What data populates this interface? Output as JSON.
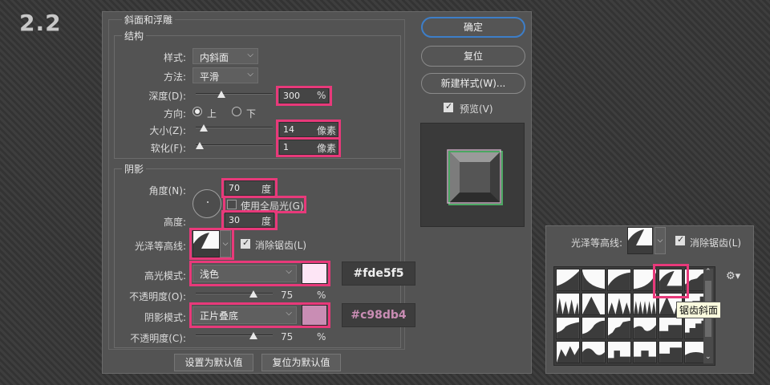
{
  "step_label": "2.2",
  "dialog": {
    "title": "斜面和浮雕",
    "structure": {
      "title": "结构",
      "style_label": "样式:",
      "style_value": "内斜面",
      "method_label": "方法:",
      "method_value": "平滑",
      "depth_label": "深度(D):",
      "depth_value": "300",
      "depth_unit": "%",
      "depth_level": 0.33,
      "direction_label": "方向:",
      "direction_up": "上",
      "direction_down": "下",
      "direction_selected": "上",
      "size_label": "大小(Z):",
      "size_value": "14",
      "size_unit": "像素",
      "size_level": 0.1,
      "soften_label": "软化(F):",
      "soften_value": "1",
      "soften_unit": "像素",
      "soften_level": 0.05
    },
    "shading": {
      "title": "阴影",
      "angle_label": "角度(N):",
      "angle_value": "70",
      "angle_unit": "度",
      "global_light_label": "使用全局光(G)",
      "global_light_checked": false,
      "altitude_label": "高度:",
      "altitude_value": "30",
      "altitude_unit": "度",
      "gloss_contour_label": "光泽等高线:",
      "anti_alias_label": "消除锯齿(L)",
      "anti_alias_checked": true,
      "highlight_mode_label": "高光模式:",
      "highlight_mode_value": "浅色",
      "highlight_color": "#fde5f5",
      "highlight_color_code": "#fde5f5",
      "highlight_opacity_label": "不透明度(O):",
      "highlight_opacity_value": "75",
      "highlight_opacity_unit": "%",
      "shadow_mode_label": "阴影模式:",
      "shadow_mode_value": "正片叠底",
      "shadow_color": "#c98db4",
      "shadow_color_code": "#c98db4",
      "shadow_opacity_label": "不透明度(C):",
      "shadow_opacity_value": "75",
      "shadow_opacity_unit": "%",
      "opacity_level": 0.75
    },
    "set_default_label": "设置为默认值",
    "reset_default_label": "复位为默认值",
    "ok_label": "确定",
    "reset_label": "复位",
    "new_style_label": "新建样式(W)...",
    "preview_label": "预览(V)",
    "preview_checked": true,
    "highlight_accent": "#e8397a"
  },
  "contour_panel": {
    "gloss_contour_label": "光泽等高线:",
    "anti_alias_label": "消除锯齿(L)",
    "tooltip": "锯齿斜面",
    "gear_icon": "gear-icon"
  }
}
